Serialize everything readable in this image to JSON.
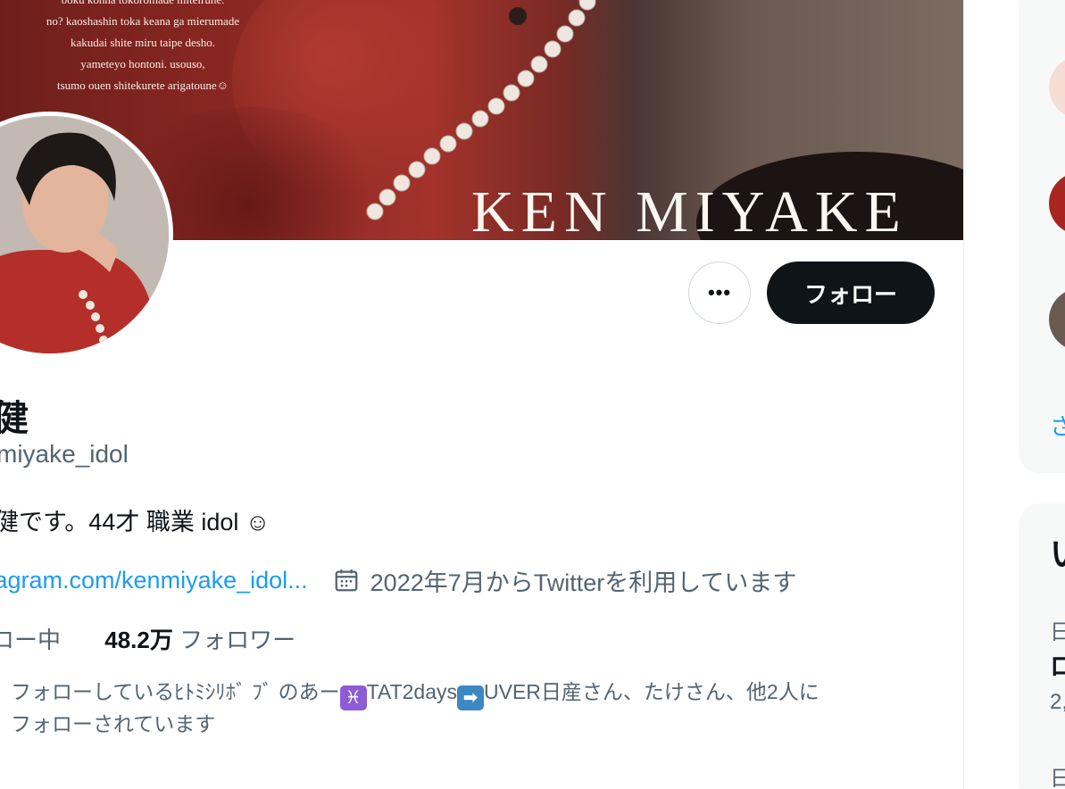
{
  "banner": {
    "lines": [
      "boku konna tokoromade miteirune.",
      "no? kaoshashin toka keana ga mierumade",
      "kakudai shite miru taipe desho.",
      "yameteyo hontoni. usouso,",
      "tsumo ouen shitekurete arigatoune☺"
    ],
    "title": "KEN MIYAKE"
  },
  "actions": {
    "more_label": "•••",
    "follow_label": "フォロー"
  },
  "profile": {
    "display_name": "健",
    "handle": "miyake_idol",
    "bio": "健です。44才 職業 idol ☺",
    "link": "tagram.com/kenmiyake_idol...",
    "joined": "2022年7月からTwitterを利用しています",
    "following_label": "ロー中",
    "followers_count": "48.2万",
    "followers_label": "フォロワー",
    "followed_by": {
      "part1": "フォローしているﾋﾄﾐｼﾘﾎﾞ ﾌﾞ のあー",
      "emoji1": "♓",
      "part2": "TAT2days",
      "emoji2": "➡",
      "part3": "UVER日産さん、たけさん、他2人に",
      "line2": "フォローされています"
    }
  },
  "sidebar": {
    "card1_link": "さ",
    "card2_title": "い",
    "card2_item1_small": "日",
    "card2_item1_big": "ロ",
    "card2_item1_count": "2,",
    "card2_item2_small": "日"
  },
  "colors": {
    "accent": "#1d9bf0",
    "follow_bg": "#0f1419",
    "muted": "#536471"
  }
}
